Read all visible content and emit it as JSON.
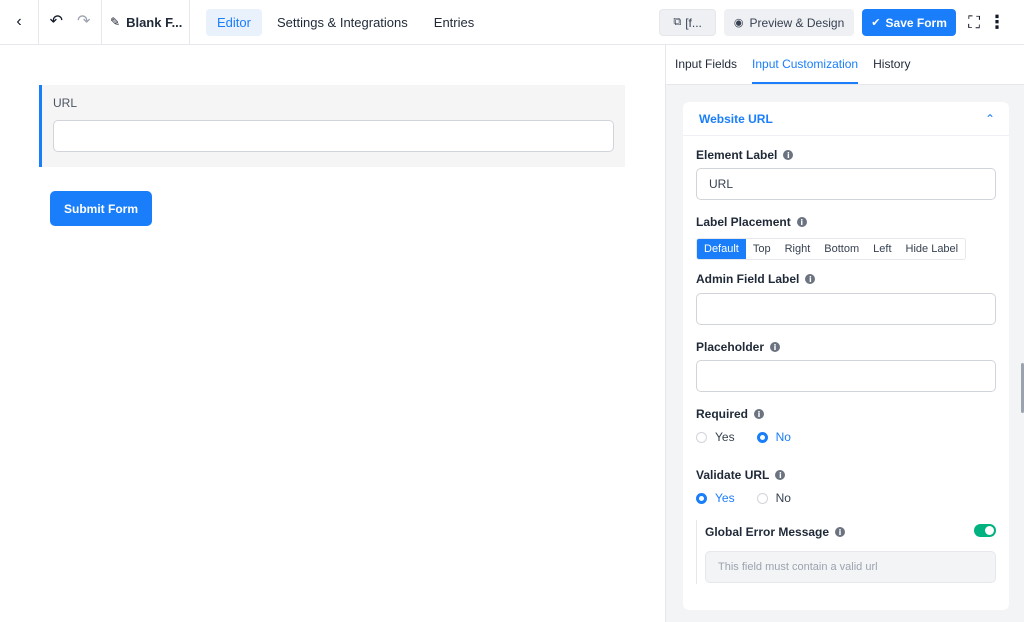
{
  "topbar": {
    "form_title": "Blank F...",
    "tabs": [
      {
        "label": "Editor",
        "active": true
      },
      {
        "label": "Settings & Integrations",
        "active": false
      },
      {
        "label": "Entries",
        "active": false
      }
    ],
    "shortcode_label": "[f...",
    "preview_label": "Preview & Design",
    "save_label": "Save Form"
  },
  "canvas": {
    "field_label": "URL",
    "submit_label": "Submit Form"
  },
  "sidebar": {
    "tabs": [
      {
        "label": "Input Fields",
        "active": false
      },
      {
        "label": "Input Customization",
        "active": true
      },
      {
        "label": "History",
        "active": false
      }
    ],
    "panel": {
      "title": "Website URL",
      "element_label": {
        "label": "Element Label",
        "value": "URL"
      },
      "label_placement": {
        "label": "Label Placement",
        "options": [
          "Default",
          "Top",
          "Right",
          "Bottom",
          "Left",
          "Hide Label"
        ],
        "selected": "Default"
      },
      "admin_field_label": {
        "label": "Admin Field Label",
        "value": ""
      },
      "placeholder": {
        "label": "Placeholder",
        "value": ""
      },
      "required": {
        "label": "Required",
        "options": [
          "Yes",
          "No"
        ],
        "selected": "No"
      },
      "validate_url": {
        "label": "Validate URL",
        "options": [
          "Yes",
          "No"
        ],
        "selected": "Yes"
      },
      "global_error": {
        "label": "Global Error Message",
        "enabled": true,
        "placeholder": "This field must contain a valid url"
      }
    }
  },
  "colors": {
    "accent": "#1a7efb",
    "toggle_on": "#00b27f"
  }
}
